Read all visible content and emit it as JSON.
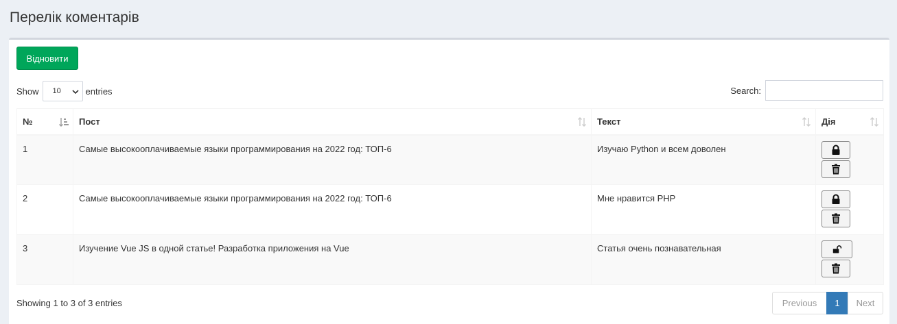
{
  "page": {
    "title": "Перелік коментарів"
  },
  "toolbar": {
    "restore_label": "Відновити"
  },
  "length": {
    "show_label": "Show",
    "value": "10",
    "entries_label": "entries"
  },
  "search": {
    "label": "Search:",
    "value": "",
    "placeholder": ""
  },
  "table": {
    "columns": [
      {
        "label": "№",
        "sort": "asc"
      },
      {
        "label": "Пост",
        "sort": "none"
      },
      {
        "label": "Текст",
        "sort": "none"
      },
      {
        "label": "Дія",
        "sort": "none"
      }
    ],
    "rows": [
      {
        "num": "1",
        "post": "Самые высокооплачиваемые языки программирования на 2022 год: ТОП-6",
        "text": "Изучаю Python и всем доволен",
        "lock_state": "locked"
      },
      {
        "num": "2",
        "post": "Самые высокооплачиваемые языки программирования на 2022 год: ТОП-6",
        "text": "Мне нравится PHP",
        "lock_state": "locked"
      },
      {
        "num": "3",
        "post": "Изучение Vue JS в одной статье! Разработка приложения на Vue",
        "text": "Статья очень познавательная",
        "lock_state": "unlocked"
      }
    ]
  },
  "footer": {
    "info": "Showing 1 to 3 of 3 entries",
    "prev_label": "Previous",
    "current_page": "1",
    "next_label": "Next"
  },
  "colors": {
    "accent_green": "#00a65a",
    "pager_active": "#337ab7",
    "background": "#ecf0f5"
  },
  "icons": {
    "lock": "lock-icon",
    "unlock": "unlock-icon",
    "delete": "trash-icon",
    "sort": "sort-icon"
  }
}
